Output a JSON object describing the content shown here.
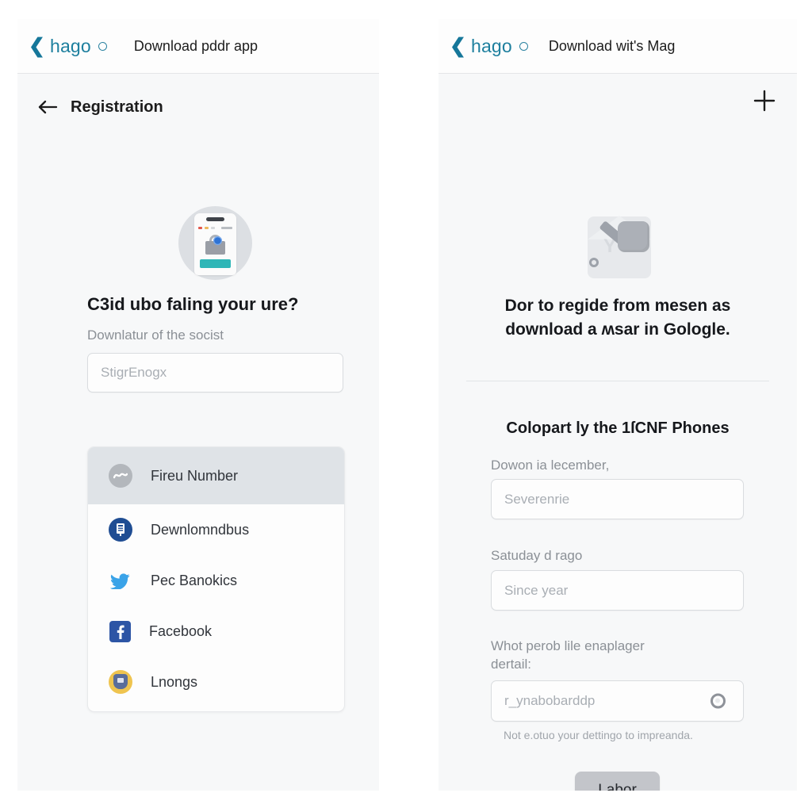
{
  "left_panel": {
    "header": {
      "back_icon": "chevron-left-icon",
      "brand": "hago",
      "brand_dot_icon": "circle-outline-icon",
      "title": "Download pddr app"
    },
    "subbar": {
      "back_icon": "arrow-left-icon",
      "title": "Registration"
    },
    "illustration": "browser-lock-globe-illustration",
    "heading": "C3id ubo faling your ure?",
    "subtitle": "Downlatur of the socist",
    "search_input": {
      "placeholder": "StigrEnogx",
      "value": ""
    },
    "options": [
      {
        "label": "Fireu Number",
        "icon": "wave-circle-icon",
        "selected": true
      },
      {
        "label": "Dewnlomndbus",
        "icon": "bank-circle-icon",
        "selected": false
      },
      {
        "label": "Pec Banokics",
        "icon": "bird-icon",
        "selected": false
      },
      {
        "label": "Facebook",
        "icon": "facebook-icon",
        "selected": false
      },
      {
        "label": "Lnongs",
        "icon": "chrome-shield-icon",
        "selected": false
      }
    ]
  },
  "right_panel": {
    "header": {
      "back_icon": "chevron-left-icon",
      "brand": "hago",
      "brand_dot_icon": "circle-outline-icon",
      "title": "Download wit's Mag"
    },
    "add_button_icon": "plus-icon",
    "illustration": "envelope-key-illustration",
    "heading_line1": "Dor to regide from mesen as",
    "heading_line2": "download a ʍsar in Gologle.",
    "section_title": "Colopart ly the 1ſCNF Phones",
    "fields": [
      {
        "label": "Dowon ia lecember,",
        "placeholder": "Severenrie",
        "value": ""
      },
      {
        "label": "Satuday d rago",
        "placeholder": "Since year",
        "value": ""
      }
    ],
    "password_field": {
      "label_line1": "Whot perob lile enaplager",
      "label_line2": "dertail:",
      "placeholder": "r_ynabobarddp",
      "value": "",
      "toggle_icon": "eye-visibility-icon",
      "helper": "Not e.otuo your dettingo to impreanda."
    },
    "submit_button": "Labor"
  },
  "colors": {
    "brand": "#1d7f9e",
    "accent_teal": "#2fb6b7",
    "panel_bg": "#f7f8f9",
    "selected_row": "#dfe3e7",
    "button_gray": "#c3c5ca"
  }
}
